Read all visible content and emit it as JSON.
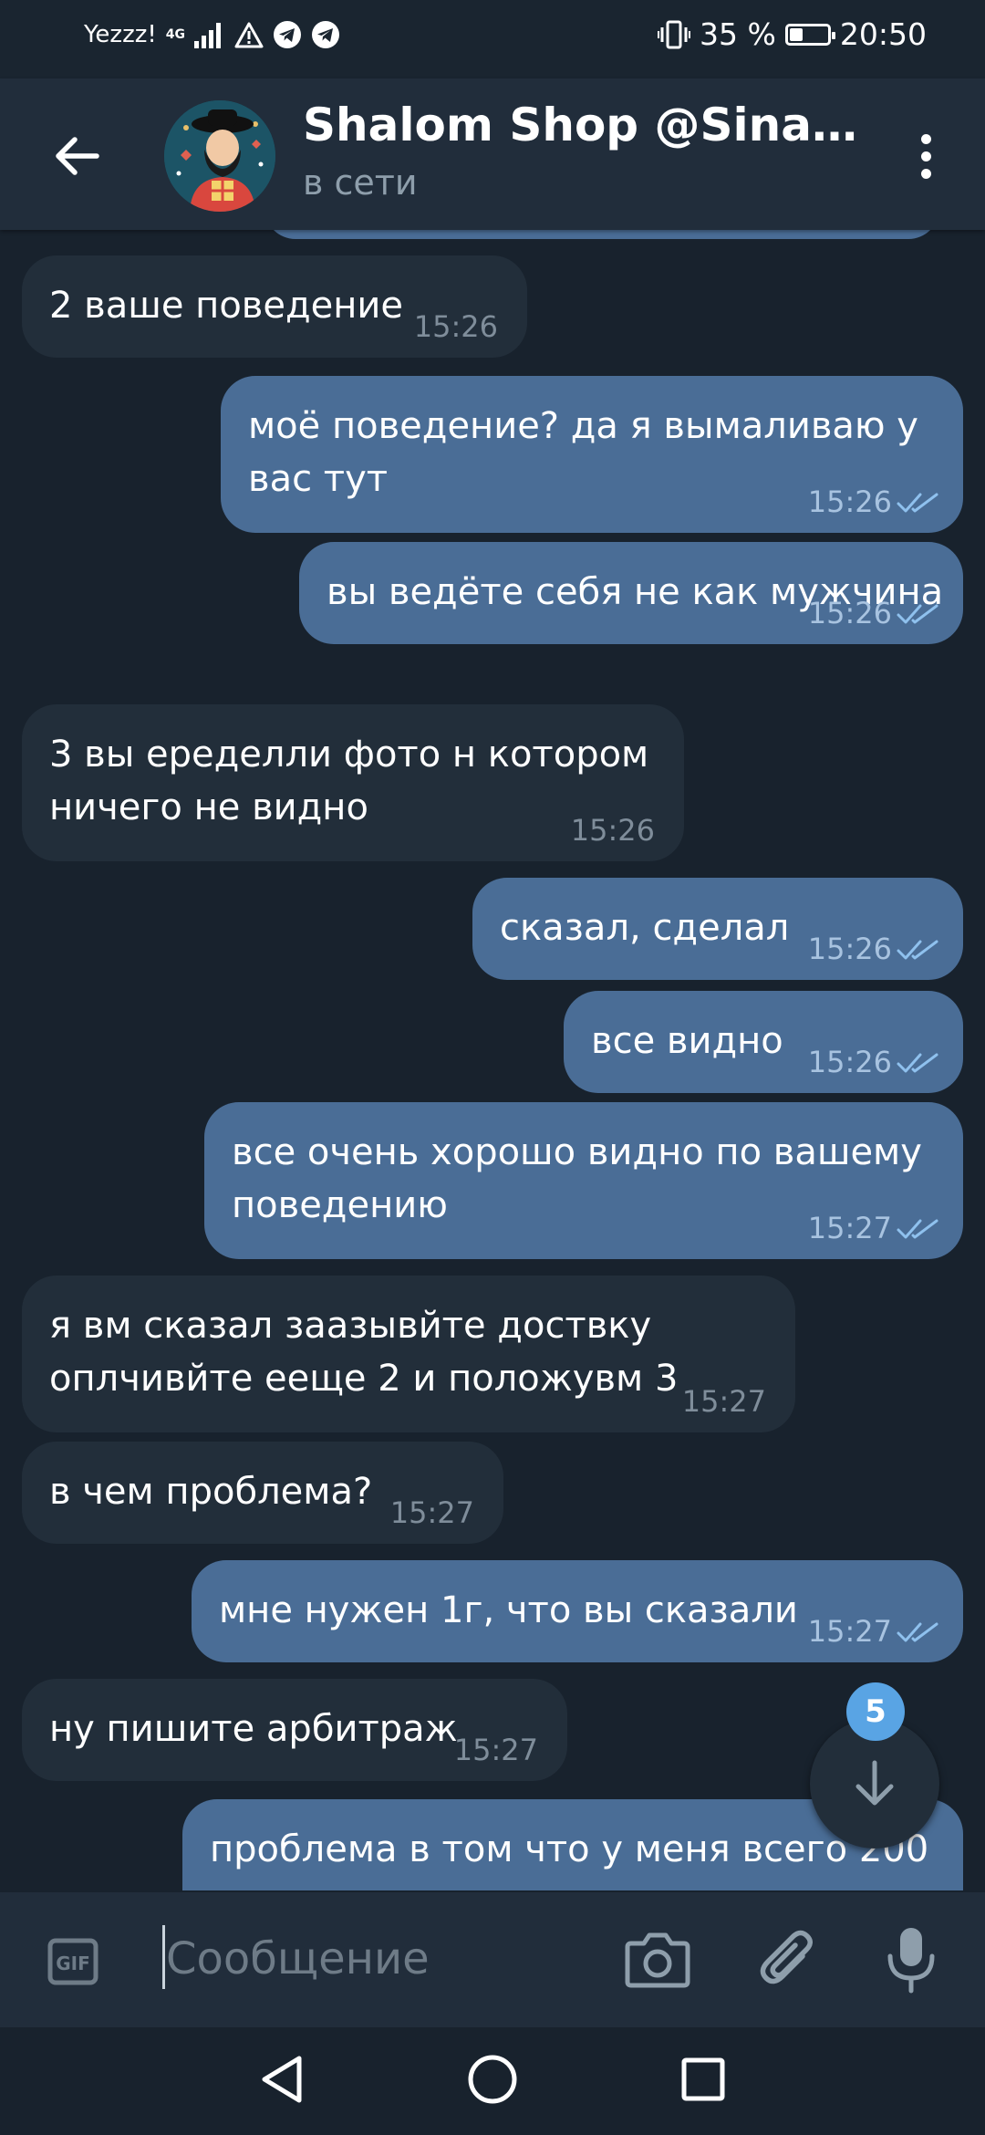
{
  "status_bar": {
    "carrier": "Yezzz!",
    "network": "4G",
    "battery_percent": "35 %",
    "battery_level": 0.35,
    "time": "20:50"
  },
  "header": {
    "title": "Shalom Shop @Sinago…",
    "status": "в сети"
  },
  "messages": [
    {
      "dir": "in",
      "lines": [
        "2 ваше поведение"
      ],
      "time": "15:26"
    },
    {
      "dir": "out",
      "lines": [
        "моё поведение? да я вымаливаю у",
        "вас тут"
      ],
      "time": "15:26",
      "read": true
    },
    {
      "dir": "out",
      "lines": [
        "вы ведёте себя не как мужчина"
      ],
      "time": "15:26",
      "read": true
    },
    {
      "dir": "in",
      "lines": [
        "3 вы еределли фото н котором",
        "ничего не видно"
      ],
      "time": "15:26"
    },
    {
      "dir": "out",
      "lines": [
        "сказал, сделал"
      ],
      "time": "15:26",
      "read": true
    },
    {
      "dir": "out",
      "lines": [
        "все видно"
      ],
      "time": "15:26",
      "read": true
    },
    {
      "dir": "out",
      "lines": [
        "все очень хорошо видно по вашему",
        "поведению"
      ],
      "time": "15:27",
      "read": true
    },
    {
      "dir": "in",
      "lines": [
        "я вм сказал заазывйте доствку",
        "оплчивйте еещe 2 и положувм 3"
      ],
      "time": "15:27"
    },
    {
      "dir": "in",
      "lines": [
        "в чем проблема?"
      ],
      "time": "15:27"
    },
    {
      "dir": "out",
      "lines": [
        "мне нужен 1г, что вы сказали"
      ],
      "time": "15:27",
      "read": true
    },
    {
      "dir": "in",
      "lines": [
        "ну пишите арбитраж"
      ],
      "time": "15:27"
    },
    {
      "dir": "out",
      "lines": [
        "проблема в том что у меня всего 200"
      ],
      "time": ""
    }
  ],
  "scroll_down": {
    "badge": "5"
  },
  "composer": {
    "placeholder": "Сообщение"
  },
  "icons": {
    "back": "arrow-left-icon",
    "menu": "more-vert-icon",
    "gif": "gif-icon",
    "camera": "camera-icon",
    "attach": "paperclip-icon",
    "mic": "microphone-icon"
  },
  "colors": {
    "background": "#18222d",
    "header": "#212d3b",
    "incoming_bubble": "#222e3a",
    "outgoing_bubble": "#4a6d96",
    "badge": "#59a4e4"
  }
}
